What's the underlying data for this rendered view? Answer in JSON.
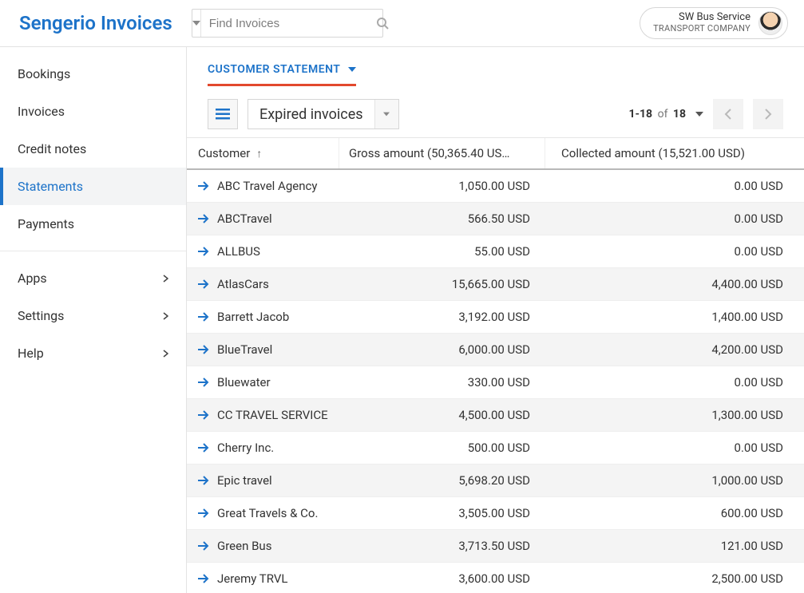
{
  "brand": "Sengerio Invoices",
  "search": {
    "placeholder": "Find Invoices"
  },
  "user": {
    "name": "SW Bus Service",
    "subtitle": "TRANSPORT COMPANY"
  },
  "sidebar": {
    "main": [
      {
        "label": "Bookings",
        "active": false
      },
      {
        "label": "Invoices",
        "active": false
      },
      {
        "label": "Credit notes",
        "active": false
      },
      {
        "label": "Statements",
        "active": true
      },
      {
        "label": "Payments",
        "active": false
      }
    ],
    "bottom": [
      {
        "label": "Apps"
      },
      {
        "label": "Settings"
      },
      {
        "label": "Help"
      }
    ]
  },
  "tab": {
    "label": "CUSTOMER STATEMENT"
  },
  "filter": {
    "label": "Expired invoices"
  },
  "pagination": {
    "range": "1-18",
    "of_text": "of",
    "total": "18"
  },
  "columns": {
    "customer": "Customer",
    "gross": "Gross amount (50,365.40 US…",
    "collected": "Collected amount (15,521.00 USD)"
  },
  "rows": [
    {
      "customer": "ABC Travel Agency",
      "gross": "1,050.00 USD",
      "collected": "0.00 USD"
    },
    {
      "customer": "ABCTravel",
      "gross": "566.50 USD",
      "collected": "0.00 USD"
    },
    {
      "customer": "ALLBUS",
      "gross": "55.00 USD",
      "collected": "0.00 USD"
    },
    {
      "customer": "AtlasCars",
      "gross": "15,665.00 USD",
      "collected": "4,400.00 USD"
    },
    {
      "customer": "Barrett Jacob",
      "gross": "3,192.00 USD",
      "collected": "1,400.00 USD"
    },
    {
      "customer": "BlueTravel",
      "gross": "6,000.00 USD",
      "collected": "4,200.00 USD"
    },
    {
      "customer": "Bluewater",
      "gross": "330.00 USD",
      "collected": "0.00 USD"
    },
    {
      "customer": "CC TRAVEL SERVICE",
      "gross": "4,500.00 USD",
      "collected": "1,300.00 USD"
    },
    {
      "customer": "Cherry Inc.",
      "gross": "500.00 USD",
      "collected": "0.00 USD"
    },
    {
      "customer": "Epic travel",
      "gross": "5,698.20 USD",
      "collected": "1,000.00 USD"
    },
    {
      "customer": "Great Travels & Co.",
      "gross": "3,505.00 USD",
      "collected": "600.00 USD"
    },
    {
      "customer": "Green Bus",
      "gross": "3,713.50 USD",
      "collected": "121.00 USD"
    },
    {
      "customer": "Jeremy TRVL",
      "gross": "3,600.00 USD",
      "collected": "2,500.00 USD"
    }
  ]
}
